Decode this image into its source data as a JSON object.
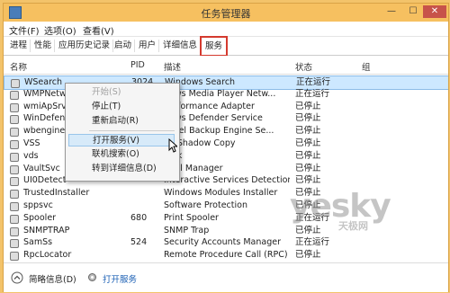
{
  "window": {
    "title": "任务管理器",
    "min": "—",
    "max": "☐",
    "close": "✕"
  },
  "menu": [
    "文件(F)",
    "选项(O)",
    "查看(V)"
  ],
  "tabs": [
    "进程",
    "性能",
    "应用历史记录",
    "启动",
    "用户",
    "详细信息",
    "服务"
  ],
  "columns": {
    "name": "名称",
    "pid": "PID",
    "desc": "描述",
    "status": "状态",
    "group": "组"
  },
  "rows": [
    {
      "name": "WSearch",
      "pid": "3024",
      "desc": "Windows Search",
      "status": "正在运行"
    },
    {
      "name": "WMPNetwo",
      "pid": "",
      "desc": "dows Media Player Netw...",
      "status": "正在运行"
    },
    {
      "name": "wmiApSrv",
      "pid": "",
      "desc": "Performance Adapter",
      "status": "已停止"
    },
    {
      "name": "WinDefend",
      "pid": "",
      "desc": "dows Defender Service",
      "status": "已停止"
    },
    {
      "name": "wbengine",
      "pid": "",
      "desc": "Level Backup Engine Se...",
      "status": "已停止"
    },
    {
      "name": "VSS",
      "pid": "",
      "desc": "ne Shadow Copy",
      "status": "已停止"
    },
    {
      "name": "vds",
      "pid": "",
      "desc": "Disk",
      "status": "已停止"
    },
    {
      "name": "VaultSvc",
      "pid": "",
      "desc": "ntial Manager",
      "status": "已停止"
    },
    {
      "name": "UI0Detect",
      "pid": "",
      "desc": "Interactive Services Detection",
      "status": "已停止"
    },
    {
      "name": "TrustedInstaller",
      "pid": "",
      "desc": "Windows Modules Installer",
      "status": "已停止"
    },
    {
      "name": "sppsvc",
      "pid": "",
      "desc": "Software Protection",
      "status": "已停止"
    },
    {
      "name": "Spooler",
      "pid": "680",
      "desc": "Print Spooler",
      "status": "正在运行"
    },
    {
      "name": "SNMPTRAP",
      "pid": "",
      "desc": "SNMP Trap",
      "status": "已停止"
    },
    {
      "name": "SamSs",
      "pid": "524",
      "desc": "Security Accounts Manager",
      "status": "正在运行"
    },
    {
      "name": "RpcLocator",
      "pid": "",
      "desc": "Remote Procedure Call (RPC) ...",
      "status": "已停止"
    }
  ],
  "context_menu": {
    "start": "开始(S)",
    "stop": "停止(T)",
    "restart": "重新启动(R)",
    "open_services": "打开服务(V)",
    "search_online": "联机搜索(O)",
    "goto_details": "转到详细信息(D)"
  },
  "statusbar": {
    "brief": "简略信息(D)",
    "open_services": "打开服务"
  },
  "watermark": {
    "main": "yesky",
    "sub": "天极网"
  },
  "colors": {
    "frame": "#f6c060",
    "selected": "#cde8ff",
    "active_tab_border": "#d43a2f"
  }
}
